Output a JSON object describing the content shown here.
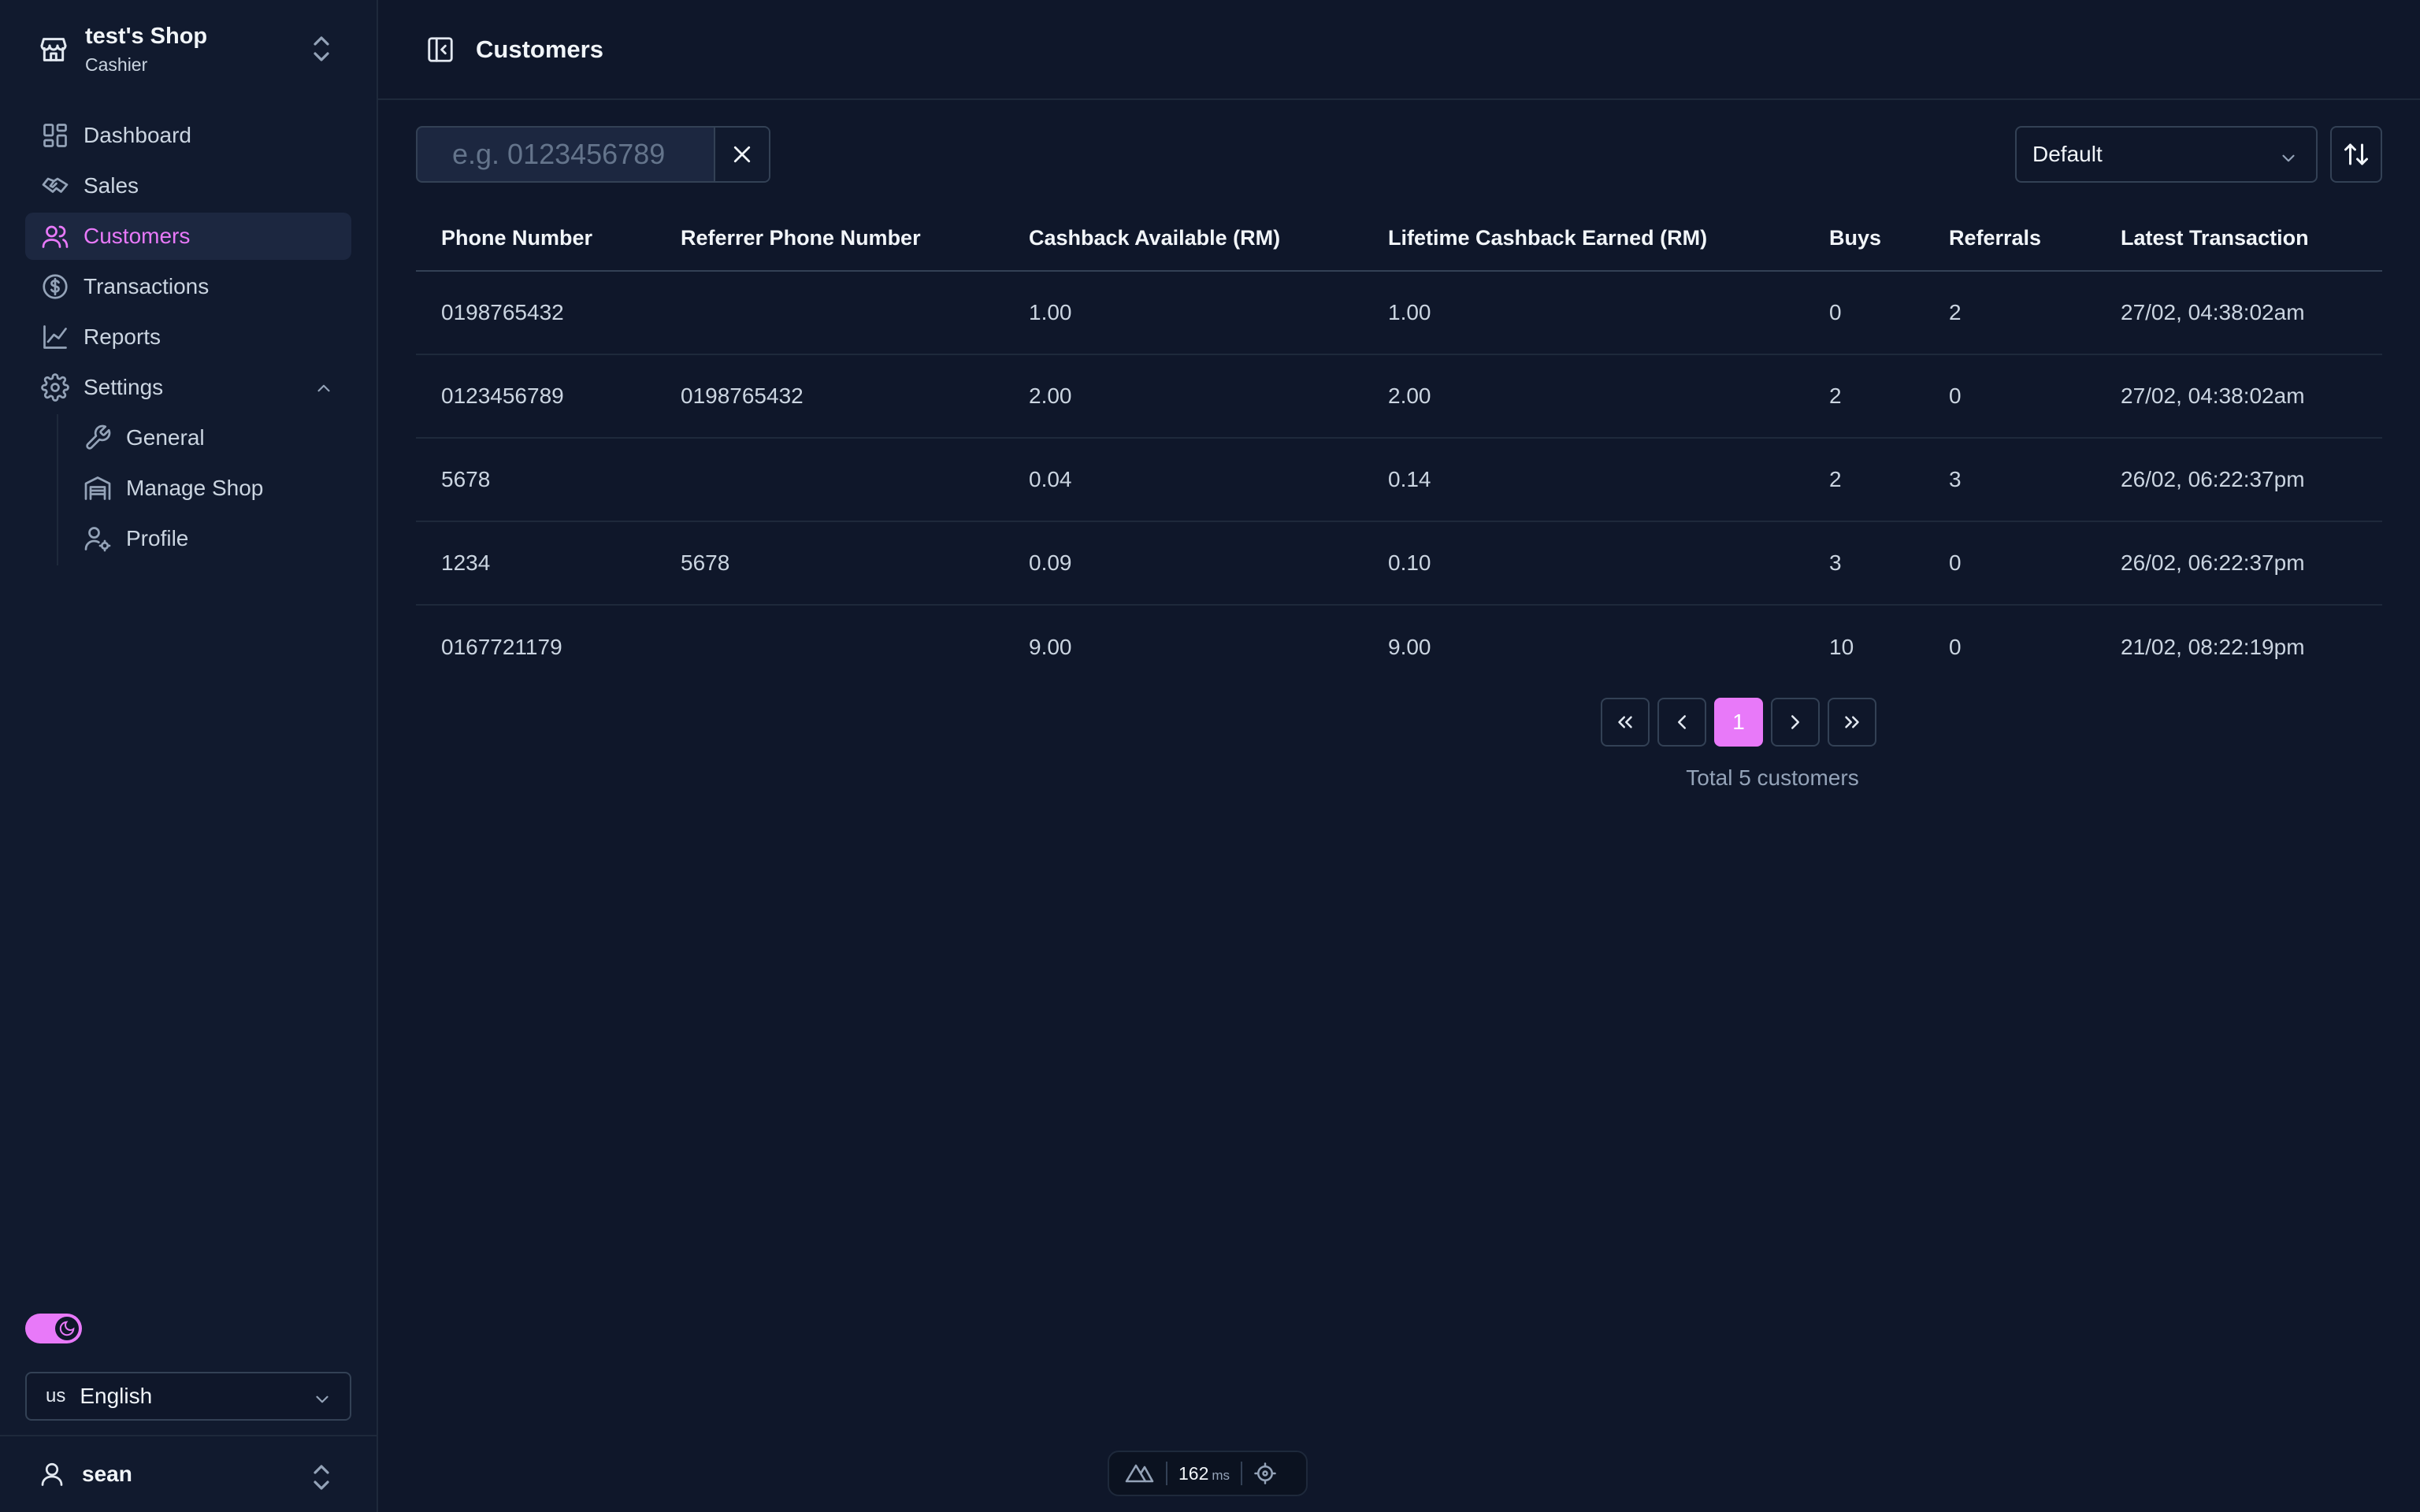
{
  "sidebar": {
    "shop": {
      "name": "test's Shop",
      "role": "Cashier"
    },
    "nav": [
      {
        "label": "Dashboard",
        "icon": "dashboard-icon"
      },
      {
        "label": "Sales",
        "icon": "handshake-icon"
      },
      {
        "label": "Customers",
        "icon": "users-icon",
        "active": true
      },
      {
        "label": "Transactions",
        "icon": "dollar-circle-icon"
      },
      {
        "label": "Reports",
        "icon": "line-chart-icon"
      },
      {
        "label": "Settings",
        "icon": "gear-icon",
        "expanded": true
      }
    ],
    "settings_sub": [
      {
        "label": "General",
        "icon": "wrench-icon"
      },
      {
        "label": "Manage Shop",
        "icon": "warehouse-icon"
      },
      {
        "label": "Profile",
        "icon": "user-gear-icon"
      }
    ],
    "language": {
      "code": "us",
      "name": "English"
    },
    "user": {
      "name": "sean"
    }
  },
  "header": {
    "title": "Customers"
  },
  "toolbar": {
    "search_placeholder": "e.g. 0123456789",
    "sort_value": "Default"
  },
  "table": {
    "columns": [
      "Phone Number",
      "Referrer Phone Number",
      "Cashback Available (RM)",
      "Lifetime Cashback Earned (RM)",
      "Buys",
      "Referrals",
      "Latest Transaction"
    ],
    "rows": [
      [
        "0198765432",
        "",
        "1.00",
        "1.00",
        "0",
        "2",
        "27/02, 04:38:02am"
      ],
      [
        "0123456789",
        "0198765432",
        "2.00",
        "2.00",
        "2",
        "0",
        "27/02, 04:38:02am"
      ],
      [
        "5678",
        "",
        "0.04",
        "0.14",
        "2",
        "3",
        "26/02, 06:22:37pm"
      ],
      [
        "1234",
        "5678",
        "0.09",
        "0.10",
        "3",
        "0",
        "26/02, 06:22:37pm"
      ],
      [
        "0167721179",
        "",
        "9.00",
        "9.00",
        "10",
        "0",
        "21/02, 08:22:19pm"
      ]
    ]
  },
  "pagination": {
    "current": "1",
    "total_text": "Total 5 customers"
  },
  "devtools": {
    "ms": "162",
    "unit": "ms"
  },
  "colors": {
    "accent": "#e879f9",
    "background": "#0f172a",
    "sidebar": "#111a2e"
  }
}
